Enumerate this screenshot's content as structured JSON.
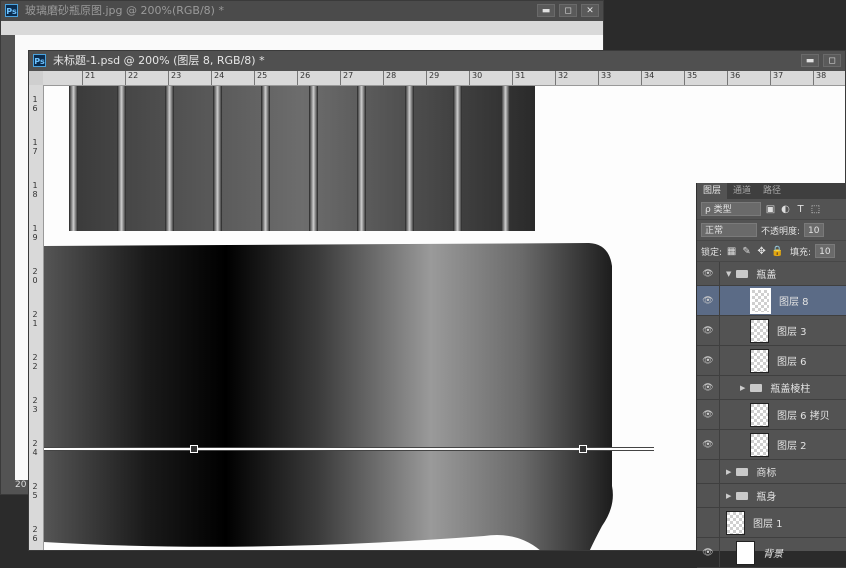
{
  "back_window": {
    "app_icon": "Ps",
    "title": "玻璃磨砂瓶原图.jpg @ 200%(RGB/8) *",
    "status": "20"
  },
  "front_window": {
    "app_icon": "Ps",
    "title": "未标题-1.psd @ 200% (图层 8, RGB/8) *",
    "ruler_h": [
      "21",
      "22",
      "23",
      "24",
      "25",
      "26",
      "27",
      "28",
      "29",
      "30",
      "31",
      "32",
      "33",
      "34",
      "35",
      "36",
      "37",
      "38"
    ],
    "ruler_v": [
      "1\n6",
      "1\n7",
      "1\n8",
      "1\n9",
      "2\n0",
      "2\n1",
      "2\n2",
      "2\n3",
      "2\n4",
      "2\n5",
      "2\n6"
    ]
  },
  "window_buttons": {
    "minimize": "▬",
    "maximize": "◻",
    "close": "✕"
  },
  "layers_panel": {
    "tabs": [
      "图层",
      "通道",
      "路径"
    ],
    "filter_kind": "ρ 类型",
    "blend_mode": "正常",
    "opacity_label": "不透明度:",
    "opacity_value": "10",
    "lock_label": "锁定:",
    "fill_label": "填充:",
    "fill_value": "10",
    "layers": [
      {
        "name": "瓶盖",
        "type": "group",
        "expanded": true,
        "indent": 0,
        "visible": true
      },
      {
        "name": "图层 8",
        "type": "layer",
        "indent": 1,
        "visible": true,
        "selected": true
      },
      {
        "name": "图层 3",
        "type": "layer",
        "indent": 1,
        "visible": true
      },
      {
        "name": "图层 6",
        "type": "layer",
        "indent": 1,
        "visible": true
      },
      {
        "name": "瓶盖棱柱",
        "type": "group",
        "expanded": false,
        "indent": 1,
        "visible": true
      },
      {
        "name": "图层 6 拷贝",
        "type": "layer",
        "indent": 1,
        "visible": true
      },
      {
        "name": "图层 2",
        "type": "layer",
        "indent": 1,
        "visible": true
      },
      {
        "name": "商标",
        "type": "group",
        "expanded": false,
        "indent": 0,
        "visible": false
      },
      {
        "name": "瓶身",
        "type": "group",
        "expanded": false,
        "indent": 0,
        "visible": false
      },
      {
        "name": "图层 1",
        "type": "layer",
        "indent": 0,
        "visible": false
      },
      {
        "name": "背景",
        "type": "background",
        "indent": 0,
        "visible": true
      }
    ]
  },
  "colors": {
    "selected_layer": "#5b6b86",
    "panel": "#535353",
    "accent": "#4aa3df"
  }
}
